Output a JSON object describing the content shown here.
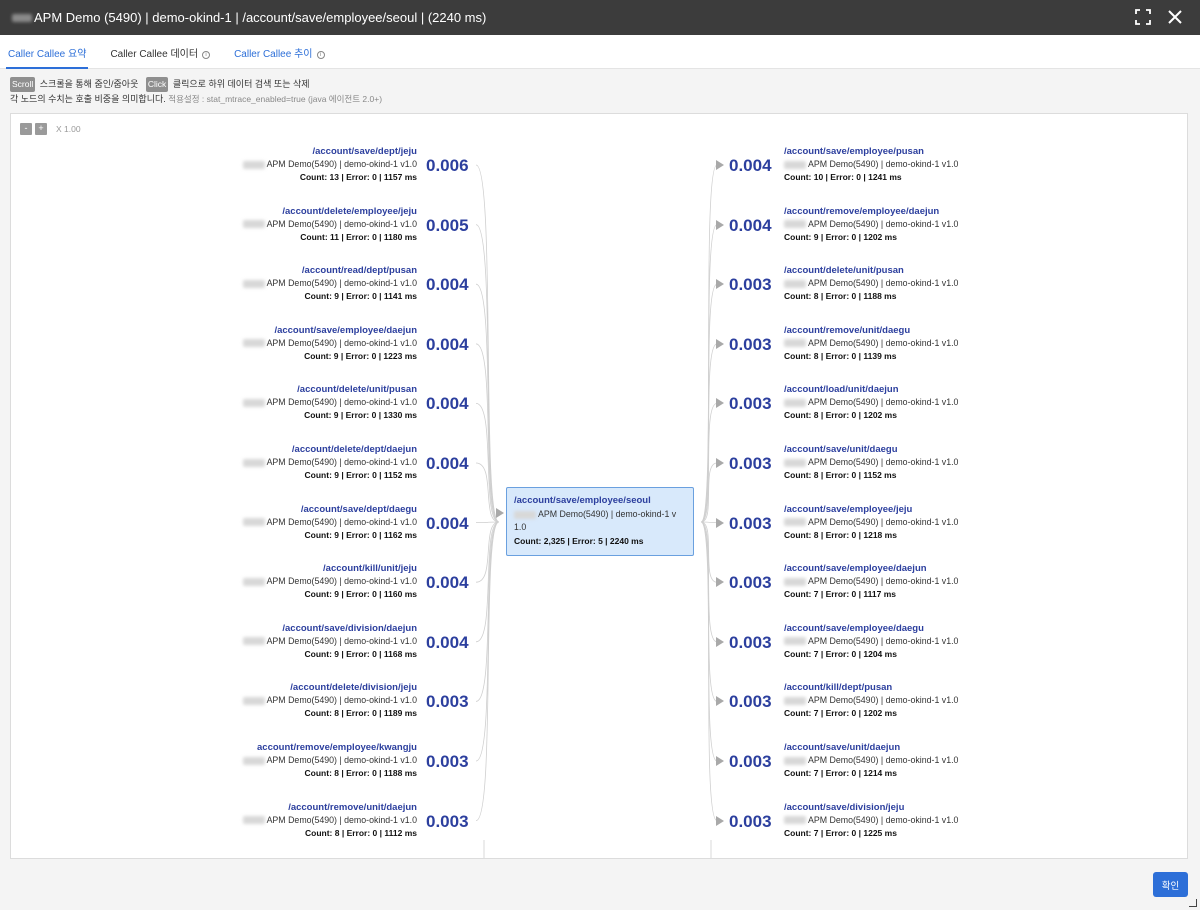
{
  "titlebar": {
    "title": "APM Demo (5490) | demo-okind-1 | /account/save/employee/seoul | (2240 ms)"
  },
  "tabs": [
    {
      "label": "Caller Callee 요약"
    },
    {
      "label": "Caller Callee 데이터"
    },
    {
      "label": "Caller Callee 추이"
    }
  ],
  "help": {
    "scroll_chip": "Scroll",
    "scroll_text": "스크롤을 통해 줌인/줌아웃",
    "click_chip": "Click",
    "click_text": "클릭으로 하위 데이터 검색 또는 삭제",
    "line2": "각 노드의 수치는 호출 비중을 의미합니다.",
    "line2_note": "적용설정 : stat_mtrace_enabled=true (java 에이전트 2.0+)"
  },
  "zoom": {
    "minus": "-",
    "plus": "+",
    "label": "X 1.00"
  },
  "center": {
    "path": "/account/save/employee/seoul",
    "app": "APM Demo(5490) | demo-okind-1 v 1.0",
    "stats": "Count: 2,325 | Error: 5 | 2240 ms"
  },
  "callers": [
    {
      "path": "/account/save/dept/jeju",
      "app": "APM Demo(5490) | demo-okind-1 v1.0",
      "stats": "Count: 13 | Error: 0 | 1157 ms",
      "value": "0.006"
    },
    {
      "path": "/account/delete/employee/jeju",
      "app": "APM Demo(5490) | demo-okind-1 v1.0",
      "stats": "Count: 11 | Error: 0 | 1180 ms",
      "value": "0.005"
    },
    {
      "path": "/account/read/dept/pusan",
      "app": "APM Demo(5490) | demo-okind-1 v1.0",
      "stats": "Count: 9 | Error: 0 | 1141 ms",
      "value": "0.004"
    },
    {
      "path": "/account/save/employee/daejun",
      "app": "APM Demo(5490) | demo-okind-1 v1.0",
      "stats": "Count: 9 | Error: 0 | 1223 ms",
      "value": "0.004"
    },
    {
      "path": "/account/delete/unit/pusan",
      "app": "APM Demo(5490) | demo-okind-1 v1.0",
      "stats": "Count: 9 | Error: 0 | 1330 ms",
      "value": "0.004"
    },
    {
      "path": "/account/delete/dept/daejun",
      "app": "APM Demo(5490) | demo-okind-1 v1.0",
      "stats": "Count: 9 | Error: 0 | 1152 ms",
      "value": "0.004"
    },
    {
      "path": "/account/save/dept/daegu",
      "app": "APM Demo(5490) | demo-okind-1 v1.0",
      "stats": "Count: 9 | Error: 0 | 1162 ms",
      "value": "0.004"
    },
    {
      "path": "/account/kill/unit/jeju",
      "app": "APM Demo(5490) | demo-okind-1 v1.0",
      "stats": "Count: 9 | Error: 0 | 1160 ms",
      "value": "0.004"
    },
    {
      "path": "/account/save/division/daejun",
      "app": "APM Demo(5490) | demo-okind-1 v1.0",
      "stats": "Count: 9 | Error: 0 | 1168 ms",
      "value": "0.004"
    },
    {
      "path": "/account/delete/division/jeju",
      "app": "APM Demo(5490) | demo-okind-1 v1.0",
      "stats": "Count: 8 | Error: 0 | 1189 ms",
      "value": "0.003"
    },
    {
      "path": "account/remove/employee/kwangju",
      "app": "APM Demo(5490) | demo-okind-1 v1.0",
      "stats": "Count: 8 | Error: 0 | 1188 ms",
      "value": "0.003"
    },
    {
      "path": "/account/remove/unit/daejun",
      "app": "APM Demo(5490) | demo-okind-1 v1.0",
      "stats": "Count: 8 | Error: 0 | 1112 ms",
      "value": "0.003"
    }
  ],
  "callees": [
    {
      "path": "/account/save/employee/pusan",
      "app": "APM Demo(5490) | demo-okind-1 v1.0",
      "stats": "Count: 10 | Error: 0 | 1241 ms",
      "value": "0.004"
    },
    {
      "path": "/account/remove/employee/daejun",
      "app": "APM Demo(5490) | demo-okind-1 v1.0",
      "stats": "Count: 9 | Error: 0 | 1202 ms",
      "value": "0.004"
    },
    {
      "path": "/account/delete/unit/pusan",
      "app": "APM Demo(5490) | demo-okind-1 v1.0",
      "stats": "Count: 8 | Error: 0 | 1188 ms",
      "value": "0.003"
    },
    {
      "path": "/account/remove/unit/daegu",
      "app": "APM Demo(5490) | demo-okind-1 v1.0",
      "stats": "Count: 8 | Error: 0 | 1139 ms",
      "value": "0.003"
    },
    {
      "path": "/account/load/unit/daejun",
      "app": "APM Demo(5490) | demo-okind-1 v1.0",
      "stats": "Count: 8 | Error: 0 | 1202 ms",
      "value": "0.003"
    },
    {
      "path": "/account/save/unit/daegu",
      "app": "APM Demo(5490) | demo-okind-1 v1.0",
      "stats": "Count: 8 | Error: 0 | 1152 ms",
      "value": "0.003"
    },
    {
      "path": "/account/save/employee/jeju",
      "app": "APM Demo(5490) | demo-okind-1 v1.0",
      "stats": "Count: 8 | Error: 0 | 1218 ms",
      "value": "0.003"
    },
    {
      "path": "/account/save/employee/daejun",
      "app": "APM Demo(5490) | demo-okind-1 v1.0",
      "stats": "Count: 7 | Error: 0 | 1117 ms",
      "value": "0.003"
    },
    {
      "path": "/account/save/employee/daegu",
      "app": "APM Demo(5490) | demo-okind-1 v1.0",
      "stats": "Count: 7 | Error: 0 | 1204 ms",
      "value": "0.003"
    },
    {
      "path": "/account/kill/dept/pusan",
      "app": "APM Demo(5490) | demo-okind-1 v1.0",
      "stats": "Count: 7 | Error: 0 | 1202 ms",
      "value": "0.003"
    },
    {
      "path": "/account/save/unit/daejun",
      "app": "APM Demo(5490) | demo-okind-1 v1.0",
      "stats": "Count: 7 | Error: 0 | 1214 ms",
      "value": "0.003"
    },
    {
      "path": "/account/save/division/jeju",
      "app": "APM Demo(5490) | demo-okind-1 v1.0",
      "stats": "Count: 7 | Error: 0 | 1225 ms",
      "value": "0.003"
    }
  ],
  "footer": {
    "ok_label": "확인"
  }
}
